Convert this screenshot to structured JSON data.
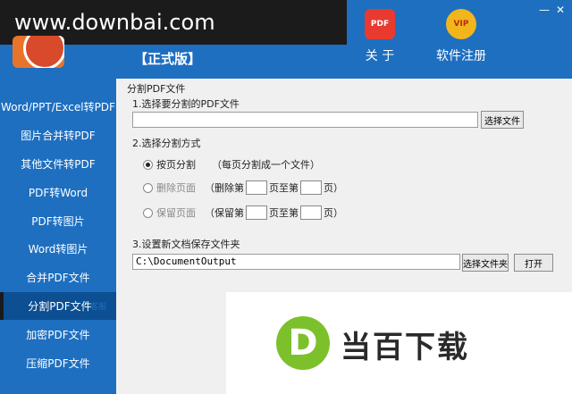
{
  "header": {
    "watermark": "www.downbai.com",
    "edition": "【正式版】",
    "about_label": "关 于",
    "about_icon_text": "PDF",
    "register_label": "软件注册",
    "register_icon_text": "VIP",
    "minimize": "—",
    "close": "✕"
  },
  "sidebar": {
    "items": [
      {
        "label": "Word/PPT/Excel转PDF"
      },
      {
        "label": "图片合并转PDF"
      },
      {
        "label": "其他文件转PDF"
      },
      {
        "label": "PDF转Word"
      },
      {
        "label": "PDF转图片"
      },
      {
        "label": "Word转图片"
      },
      {
        "label": "合并PDF文件"
      },
      {
        "label": "分割PDF文件"
      },
      {
        "label": "加密PDF文件"
      },
      {
        "label": "压缩PDF文件"
      }
    ],
    "active_index": 7
  },
  "main": {
    "group_title": "分割PDF文件",
    "step1": "1.选择要分割的PDF文件",
    "file_path": "",
    "select_file": "选择文件",
    "step2": "2.选择分割方式",
    "opt1_label": "按页分割",
    "opt1_desc": "（每页分割成一个文件）",
    "opt2_label": "删除页面",
    "opt2_prefix": "（删除第",
    "opt2_mid": "页至第",
    "opt2_suffix": "页）",
    "opt3_label": "保留页面",
    "opt3_prefix": "（保留第",
    "opt3_mid": "页至第",
    "opt3_suffix": "页）",
    "step3": "3.设置新文档保存文件夹",
    "output_path": "C:\\DocumentOutput",
    "select_folder": "选择文件夹",
    "open": "打开",
    "service": "客服"
  },
  "brand": {
    "icon_letter": "D",
    "name": "当百下载"
  },
  "colors": {
    "header_blue": "#1e6fc0",
    "active_item": "#0c4f93",
    "brand_green": "#7cc12b"
  }
}
